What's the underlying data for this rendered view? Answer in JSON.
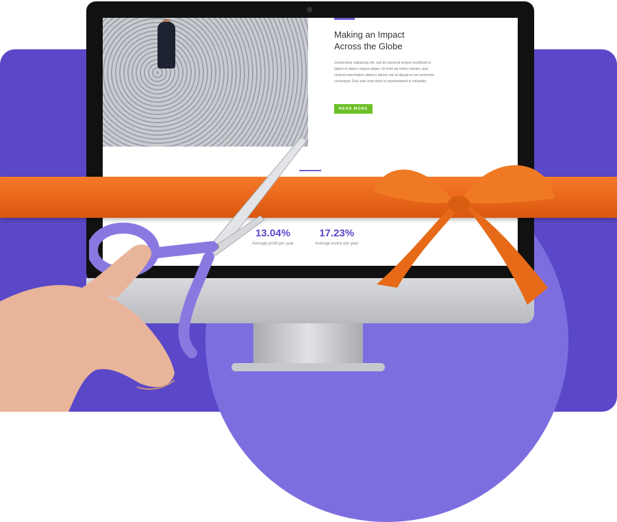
{
  "colors": {
    "background_panel": "#5a48c9",
    "background_circle": "#7d6ee0",
    "ribbon": "#ef6c1e",
    "button": "#6cc027",
    "stat_value": "#5a48c9",
    "scissors_handle": "#8a78e0"
  },
  "hero": {
    "title_line1": "Making an Impact",
    "title_line2": "Across the Globe",
    "body": "Consectetur adipiscing elit, sed do eiusmod tempor incididunt ut labore et dolore magna aliqua. Ut enim ad minim veniam, quis nostrud exercitation ullamco laboris nisi ut aliquip ex ea commodo consequat. Duis aute irure dolor in reprehenderit in voluptate.",
    "button_label": "READ MORE"
  },
  "stats": [
    {
      "value": "13.04%",
      "label": "Average profit per year"
    },
    {
      "value": "17.23%",
      "label": "Average invest per year"
    }
  ],
  "icons": {
    "scissors": "scissors-icon",
    "bow": "bow-icon",
    "hand": "hand-icon"
  }
}
